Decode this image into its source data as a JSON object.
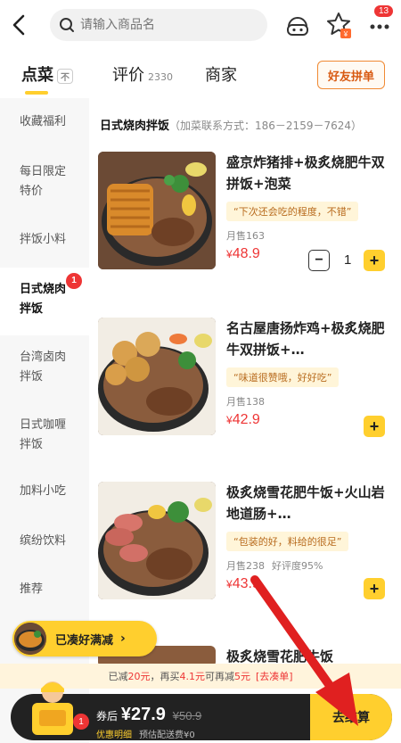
{
  "search": {
    "placeholder": "请输入商品名"
  },
  "header": {
    "message_badge": "13"
  },
  "tabs": [
    {
      "label": "点菜",
      "mini": "不"
    },
    {
      "label": "评价",
      "count": "2330"
    },
    {
      "label": "商家"
    }
  ],
  "friend_button": "好友拼单",
  "sidebar": {
    "items": [
      {
        "label": "收藏福利"
      },
      {
        "label": "每日限定特价"
      },
      {
        "label": "拌饭小料"
      },
      {
        "label": "日式烧肉拌饭",
        "badge": "1"
      },
      {
        "label": "台湾卤肉拌饭"
      },
      {
        "label": "日式咖喱拌饭"
      },
      {
        "label": "加料小吃"
      },
      {
        "label": "缤纷饮料"
      },
      {
        "label": "推荐"
      }
    ]
  },
  "category": {
    "title": "日式烧肉拌饭",
    "contact": "（加菜联系方式：186－2159－7624）"
  },
  "products": [
    {
      "name": "盛京炸猪排+极炙烧肥牛双拼饭+泡菜",
      "tag": "“下次还会吃的程度，不错”",
      "sales": "月售163",
      "rating": "",
      "price_symbol": "¥",
      "price": "48.9",
      "quantity": "1"
    },
    {
      "name": "名古屋唐扬炸鸡+极炙烧肥牛双拼饭+…",
      "tag": "“味道很赞哦，好好吃”",
      "sales": "月售138",
      "rating": "",
      "price_symbol": "¥",
      "price": "42.9"
    },
    {
      "name": "极炙烧雪花肥牛饭+火山岩地道肠+…",
      "tag": "“包装的好，料给的很足”",
      "sales": "月售238",
      "rating": "好评度95%",
      "price_symbol": "¥",
      "price": "43.9"
    },
    {
      "name": "极炙烧雪花肥牛饭",
      "tag": "",
      "sales": "",
      "rating": "",
      "price_symbol": "",
      "price": ""
    }
  ],
  "promo_pill": {
    "label": "已凑好满减"
  },
  "reduction_bar": {
    "prefix": "已减",
    "reduced": "20元",
    "mid": "，再买",
    "need": "4.1元",
    "mid2": "可再减",
    "more": "5元",
    "link": "[去凑单]"
  },
  "cart": {
    "count": "1",
    "price_prefix": "券后",
    "price": "¥27.9",
    "original": "¥50.9",
    "detail": "优惠明细",
    "delivery": "预估配送费¥0",
    "checkout": "去结算"
  },
  "colors": {
    "accent": "#ffcf2e",
    "price_red": "#ee3535",
    "annotation_arrow": "#e02020"
  }
}
